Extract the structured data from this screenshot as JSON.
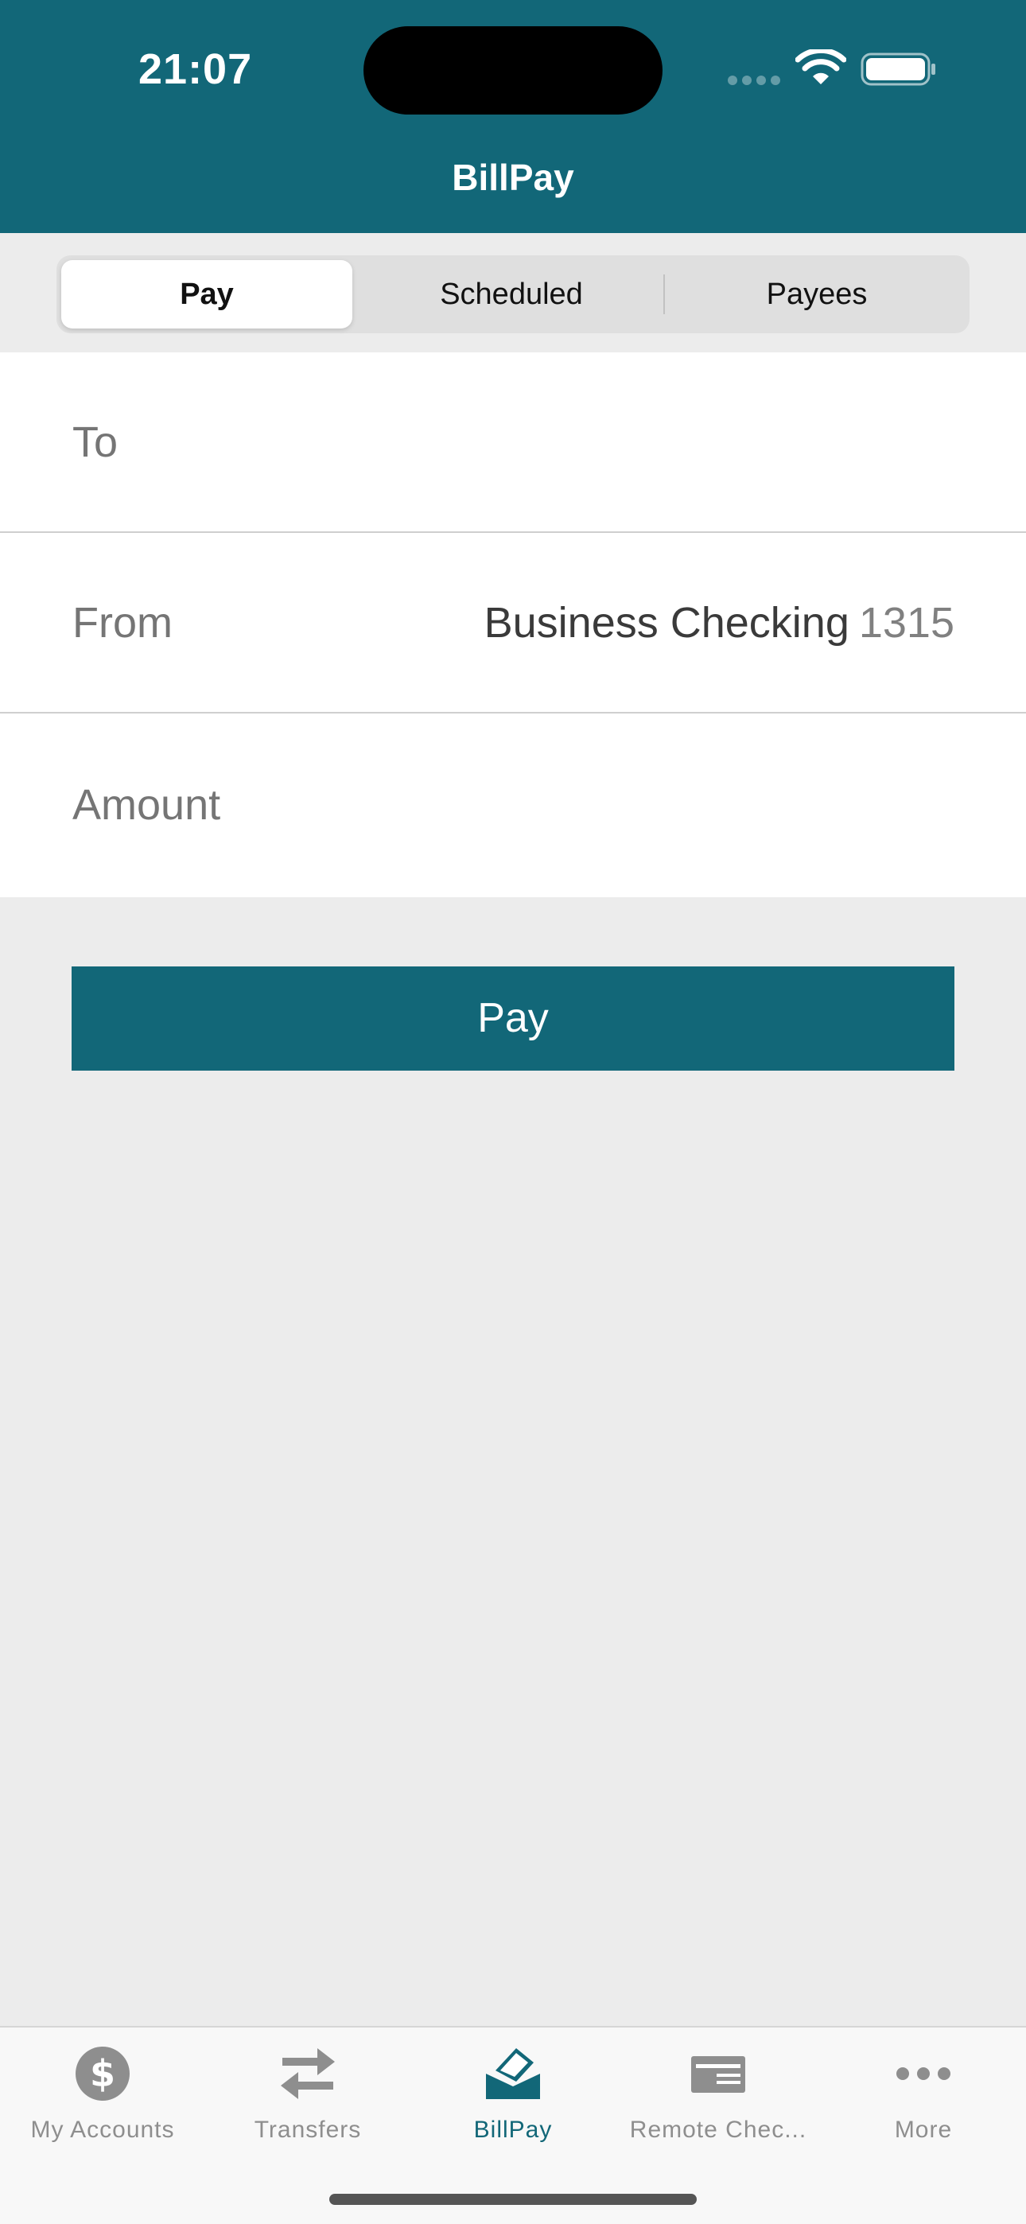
{
  "status_bar": {
    "time": "21:07"
  },
  "header": {
    "title": "BillPay"
  },
  "segments": [
    {
      "label": "Pay",
      "active": true
    },
    {
      "label": "Scheduled",
      "active": false
    },
    {
      "label": "Payees",
      "active": false
    }
  ],
  "form": {
    "to": {
      "label": "To",
      "value": ""
    },
    "from": {
      "label": "From",
      "account_name": "Business Checking",
      "account_number": "1315"
    },
    "amount": {
      "label": "Amount",
      "value": ""
    }
  },
  "pay_button": {
    "label": "Pay"
  },
  "tabbar": [
    {
      "label": "My Accounts",
      "icon": "dollar-circle-icon",
      "active": false
    },
    {
      "label": "Transfers",
      "icon": "transfer-arrows-icon",
      "active": false
    },
    {
      "label": "BillPay",
      "icon": "bill-envelope-icon",
      "active": true
    },
    {
      "label": "Remote Chec...",
      "icon": "check-deposit-icon",
      "active": false
    },
    {
      "label": "More",
      "icon": "more-dots-icon",
      "active": false
    }
  ],
  "colors": {
    "brand": "#126778",
    "background": "#ececec",
    "tab_inactive": "#8e8e8e"
  }
}
